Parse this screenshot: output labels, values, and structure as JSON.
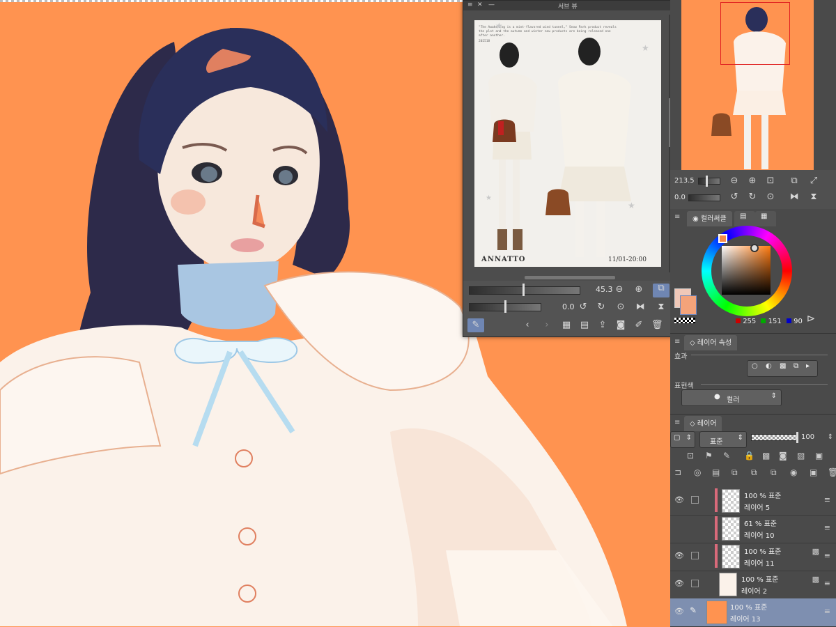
{
  "subview": {
    "title": "서브 뷰",
    "photo": {
      "caption": "\"The Awakening is a mint-flavored wind tunnel,\" Snow Park product reveals the plot and the autumn and winter new products are being released one after another.",
      "code": "202518",
      "brand": "ANNATTO",
      "date": "11/01-20:00"
    },
    "zoom_value": "45.3",
    "rotate_value": "0.0"
  },
  "navigator": {
    "zoom_value": "213.5",
    "rotate_value": "0.0"
  },
  "color_panel": {
    "tab_label": "컬러써클",
    "r": "255",
    "g": "151",
    "b": "90",
    "main_color": "#f4a37a",
    "sub_color": "#f0c8b8"
  },
  "layer_property": {
    "tab_label": "레이어 속성",
    "effect_label": "효과",
    "expression_label": "표현색",
    "expression_value": "컬러"
  },
  "layer_panel": {
    "tab_label": "레이어",
    "blend_mode": "표준",
    "opacity": "100",
    "layers": [
      {
        "opacity": "100 %",
        "mode": "표준",
        "name": "레이어 5",
        "selected": false
      },
      {
        "opacity": "61 %",
        "mode": "표준",
        "name": "레이어 10",
        "selected": false
      },
      {
        "opacity": "100 %",
        "mode": "표준",
        "name": "레이어 11",
        "selected": false
      },
      {
        "opacity": "100 %",
        "mode": "표준",
        "name": "레이어 2",
        "selected": false
      },
      {
        "opacity": "100 %",
        "mode": "표준",
        "name": "레이어 13",
        "selected": true
      }
    ]
  },
  "colors": {
    "canvas_bg": "#ff9350",
    "panel_bg": "#4a4a4a",
    "selection": "#7e8fb0",
    "hair": "#2a2f5a",
    "coat": "#fbf2ea"
  }
}
